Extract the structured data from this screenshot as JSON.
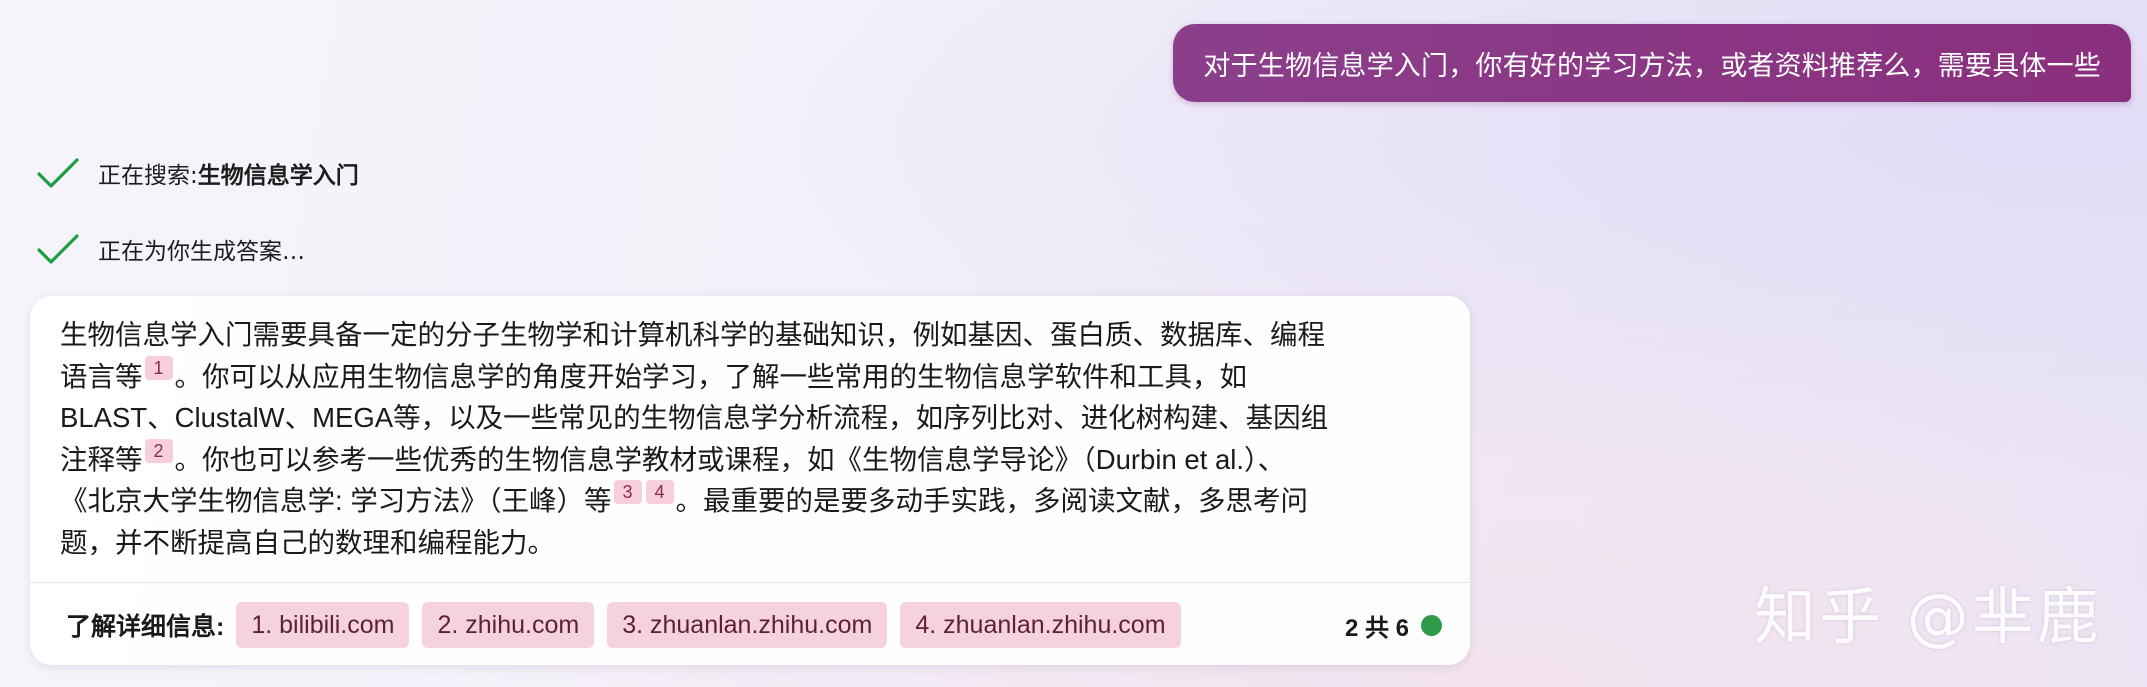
{
  "user_message": "对于生物信息学入门，你有好的学习方法，或者资料推荐么，需要具体一些",
  "status": {
    "search_prefix": "正在搜索: ",
    "search_query": "生物信息学入门",
    "generating": "正在为你生成答案…"
  },
  "answer": {
    "line1": "生物信息学入门需要具备一定的分子生物学和计算机科学的基础知识，例如基因、蛋白质、数据库、编程",
    "line2_a": "语言等",
    "cite1": "1",
    "line2_b": "。你可以从应用生物信息学的角度开始学习，了解一些常用的生物信息学软件和工具，如",
    "line3": "BLAST、ClustalW、MEGA等，以及一些常见的生物信息学分析流程，如序列比对、进化树构建、基因组",
    "line4_a": "注释等",
    "cite2": "2",
    "line4_b": "。你也可以参考一些优秀的生物信息学教材或课程，如《生物信息学导论》（Durbin et al.）、",
    "line5_a": "《北京大学生物信息学: 学习方法》（王峰）等",
    "cite3": "3",
    "cite4": "4",
    "line5_b": "。最重要的是要多动手实践，多阅读文献，多思考问",
    "line6": "题，并不断提高自己的数理和编程能力。"
  },
  "learn_more": {
    "label": "了解详细信息:",
    "sources": [
      "1. bilibili.com",
      "2. zhihu.com",
      "3. zhuanlan.zhihu.com",
      "4. zhuanlan.zhihu.com"
    ]
  },
  "page_count": "2 共 6",
  "watermark": "知乎 @芈鹿",
  "colors": {
    "user_bubble": "#8a2f7e",
    "citation_bg": "#f6cfda",
    "source_chip_bg": "#f6d3dc",
    "check": "#1e9e3e",
    "status_dot": "#2f9a4a"
  },
  "icons": {
    "check": "check-icon",
    "status_dot": "status-dot-icon"
  }
}
